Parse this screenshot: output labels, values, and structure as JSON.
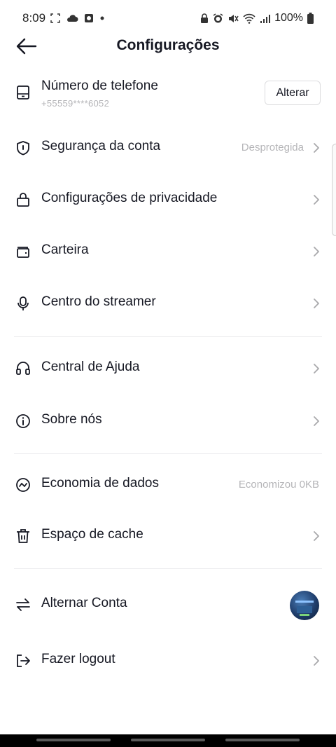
{
  "status_bar": {
    "time": "8:09",
    "battery_text": "100%",
    "left_icons": [
      "screenshot-icon",
      "cloud-icon",
      "app-icon",
      "dot-icon"
    ],
    "right_icons": [
      "lock-icon",
      "alarm-icon",
      "mute-icon",
      "wifi-icon",
      "signal-icon",
      "battery-icon"
    ]
  },
  "header": {
    "title": "Configurações",
    "back_icon": "arrow-left-icon"
  },
  "rows": {
    "phone": {
      "label": "Número de telefone",
      "sub": "+55559****6052",
      "button": "Alterar",
      "icon": "phone-icon"
    },
    "security": {
      "label": "Segurança da conta",
      "value": "Desprotegida",
      "icon": "shield-icon"
    },
    "privacy": {
      "label": "Configurações de privacidade",
      "icon": "lock-icon"
    },
    "wallet": {
      "label": "Carteira",
      "icon": "wallet-icon"
    },
    "streamer": {
      "label": "Centro do streamer",
      "icon": "microphone-icon"
    },
    "help": {
      "label": "Central de Ajuda",
      "icon": "headset-icon"
    },
    "about": {
      "label": "Sobre nós",
      "icon": "info-icon"
    },
    "data_saver": {
      "label": "Economia de dados",
      "value": "Economizou 0KB",
      "icon": "data-saver-icon"
    },
    "cache": {
      "label": "Espaço de cache",
      "icon": "trash-icon"
    },
    "switch_account": {
      "label": "Alternar Conta",
      "icon": "switch-icon"
    },
    "logout": {
      "label": "Fazer logout",
      "icon": "logout-icon"
    }
  },
  "colors": {
    "text": "#161823",
    "muted": "#b5b5b8",
    "divider": "#ececee"
  }
}
